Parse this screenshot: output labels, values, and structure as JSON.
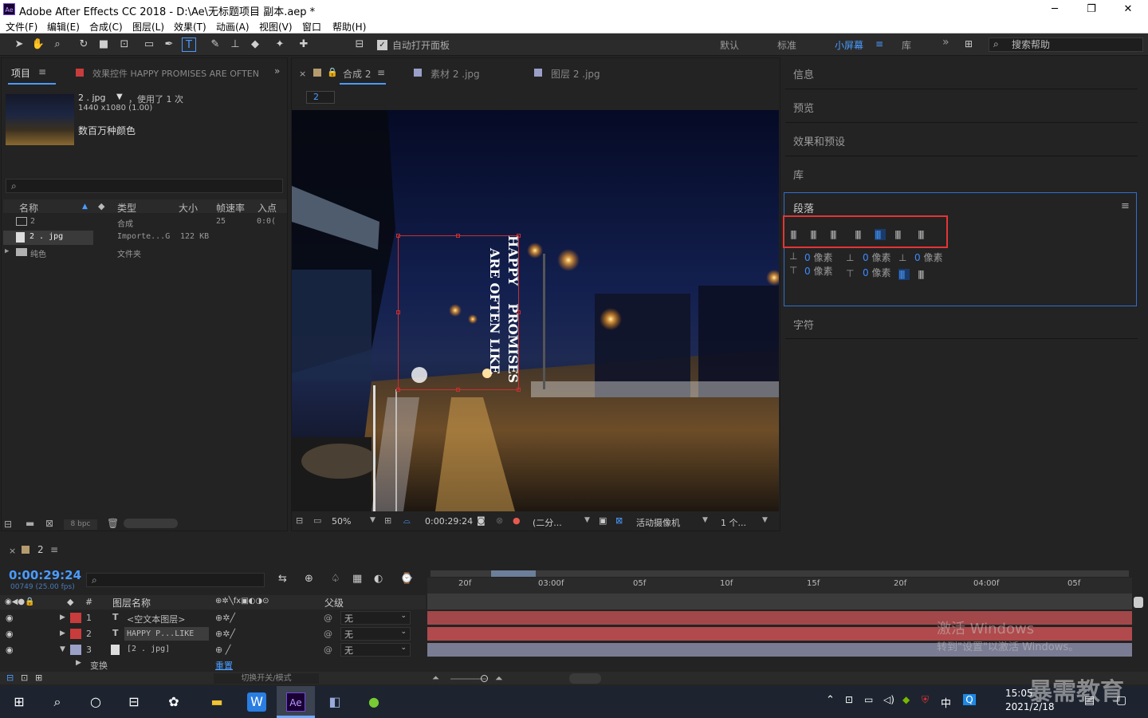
{
  "window": {
    "title": "Adobe After Effects CC 2018 - D:\\Ae\\无标题项目 副本.aep *",
    "logo": "Ae",
    "minimize": "─",
    "restore": "❐",
    "close": "✕"
  },
  "menu": [
    "文件(F)",
    "编辑(E)",
    "合成(C)",
    "图层(L)",
    "效果(T)",
    "动画(A)",
    "视图(V)",
    "窗口",
    "帮助(H)"
  ],
  "toolbar": {
    "auto_open_label": "自动打开面板",
    "workspaces": [
      "默认",
      "标准",
      "小屏幕",
      "库"
    ],
    "active_workspace": "小屏幕",
    "search_placeholder": "搜索帮助"
  },
  "project_panel": {
    "tab_project": "项目",
    "tab_effects": "效果控件 HAPPY PROMISES ARE OFTEN",
    "item_name": "2 . jpg",
    "item_used": "，使用了 1 次",
    "item_dims": "1440 x1080 (1.00)",
    "item_colors": "数百万种颜色",
    "columns": [
      "名称",
      "类型",
      "大小",
      "帧速率",
      "入点"
    ],
    "rows": [
      {
        "name": "2",
        "type": "合成",
        "size": "",
        "fps": "25",
        "in": "0:0(",
        "color": "#b59b6e"
      },
      {
        "name": "2 . jpg",
        "type": "Importe...G",
        "size": "122 KB",
        "fps": "",
        "in": "",
        "color": "#9aa0c8"
      },
      {
        "name": "纯色",
        "type": "文件夹",
        "size": "",
        "fps": "",
        "in": "",
        "color": "#e8d23a"
      }
    ],
    "bpc": "8 bpc"
  },
  "comp_panel": {
    "tabs": [
      "合成 2",
      "素材 2 .jpg",
      "图层 2 .jpg"
    ],
    "breadcrumb": "2",
    "text_line1": "HAPPY    PROMISES",
    "text_line2": "ARE OFTEN LIKE",
    "zoom": "50%",
    "timecode": "0:00:29:24",
    "resolution": "(二分...",
    "camera": "活动摄像机",
    "views": "1 个..."
  },
  "right_panels": {
    "info": "信息",
    "preview": "预览",
    "effects_presets": "效果和预设",
    "library": "库",
    "paragraph": "段落",
    "character": "字符",
    "indent_value": "0",
    "indent_unit": "像素"
  },
  "timeline": {
    "comp_name": "2",
    "timecode": "0:00:29:24",
    "frame_info": "00749 (25.00 fps)",
    "col_layer_name": "图层名称",
    "col_parent": "父级",
    "ruler": [
      "20f",
      "03:00f",
      "05f",
      "10f",
      "15f",
      "20f",
      "04:00f",
      "05f"
    ],
    "layers": [
      {
        "num": "1",
        "name": "<空文本图层>",
        "parent": "无",
        "color": "#c83c3c"
      },
      {
        "num": "2",
        "name": "HAPPY P...LIKE",
        "parent": "无",
        "color": "#c83c3c"
      },
      {
        "num": "3",
        "name": "[2 . jpg]",
        "parent": "无",
        "color": "#9aa0c8"
      }
    ],
    "transform_label": "变换",
    "reset_label": "重置",
    "toggle_label": "切换开关/模式"
  },
  "activate": {
    "line1": "激活 Windows",
    "line2": "转到\"设置\"以激活 Windows。"
  },
  "taskbar": {
    "time": "15:05    ",
    "date": "2021/2/18",
    "ime": "中"
  },
  "watermark": "暴需教育"
}
